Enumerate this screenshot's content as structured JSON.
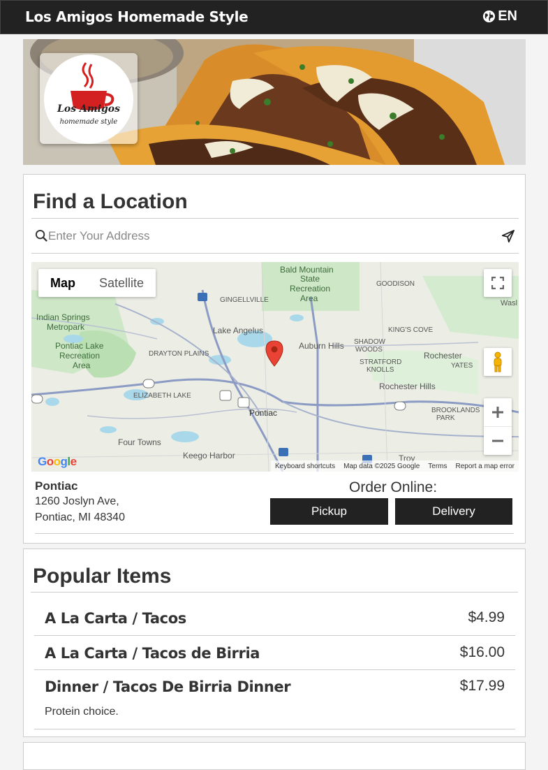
{
  "header": {
    "brand": "Los Amigos Homemade Style",
    "language": "EN"
  },
  "hero": {
    "logo_text_1": "Los Amigos",
    "logo_text_2": "homemade style"
  },
  "find_location": {
    "title": "Find a Location",
    "search_placeholder": "Enter Your Address",
    "map": {
      "type_map": "Map",
      "type_satellite": "Satellite",
      "place_labels": [
        "Bald Mountain",
        "State",
        "Recreation",
        "Area",
        "GOODISON",
        "GINGELLVILLE",
        "Indian Springs",
        "Metropark",
        "Lake Angelus",
        "KING'S COVE",
        "Auburn Hills",
        "SHADOW",
        "WOODS",
        "Rochester",
        "Pontiac Lake",
        "Recreation",
        "Area",
        "DRAYTON PLAINS",
        "STRATFORD",
        "KNOLLS",
        "YATES",
        "Rochester Hills",
        "ELIZABETH LAKE",
        "Pontiac",
        "BROOKLANDS",
        "PARK",
        "Four Towns",
        "Keego Harbor",
        "Troy",
        "Wasl"
      ],
      "google": "Google",
      "attribution": {
        "shortcuts": "Keyboard shortcuts",
        "data": "Map data ©2025 Google",
        "terms": "Terms",
        "report": "Report a map error"
      }
    },
    "location": {
      "name": "Pontiac",
      "address_line1": "1260 Joslyn Ave,",
      "address_line2": "Pontiac, MI 48340"
    },
    "order": {
      "label": "Order Online:",
      "pickup": "Pickup",
      "delivery": "Delivery"
    }
  },
  "popular": {
    "title": "Popular Items",
    "items": [
      {
        "name": "A La Carta / Tacos",
        "price": "$4.99",
        "description": ""
      },
      {
        "name": "A La Carta / Tacos de Birria",
        "price": "$16.00",
        "description": ""
      },
      {
        "name": "Dinner / Tacos De Birria Dinner",
        "price": "$17.99",
        "description": "Protein choice."
      }
    ]
  },
  "colors": {
    "header_bg": "#222222",
    "button_bg": "#222222",
    "pin": "#d93025"
  }
}
